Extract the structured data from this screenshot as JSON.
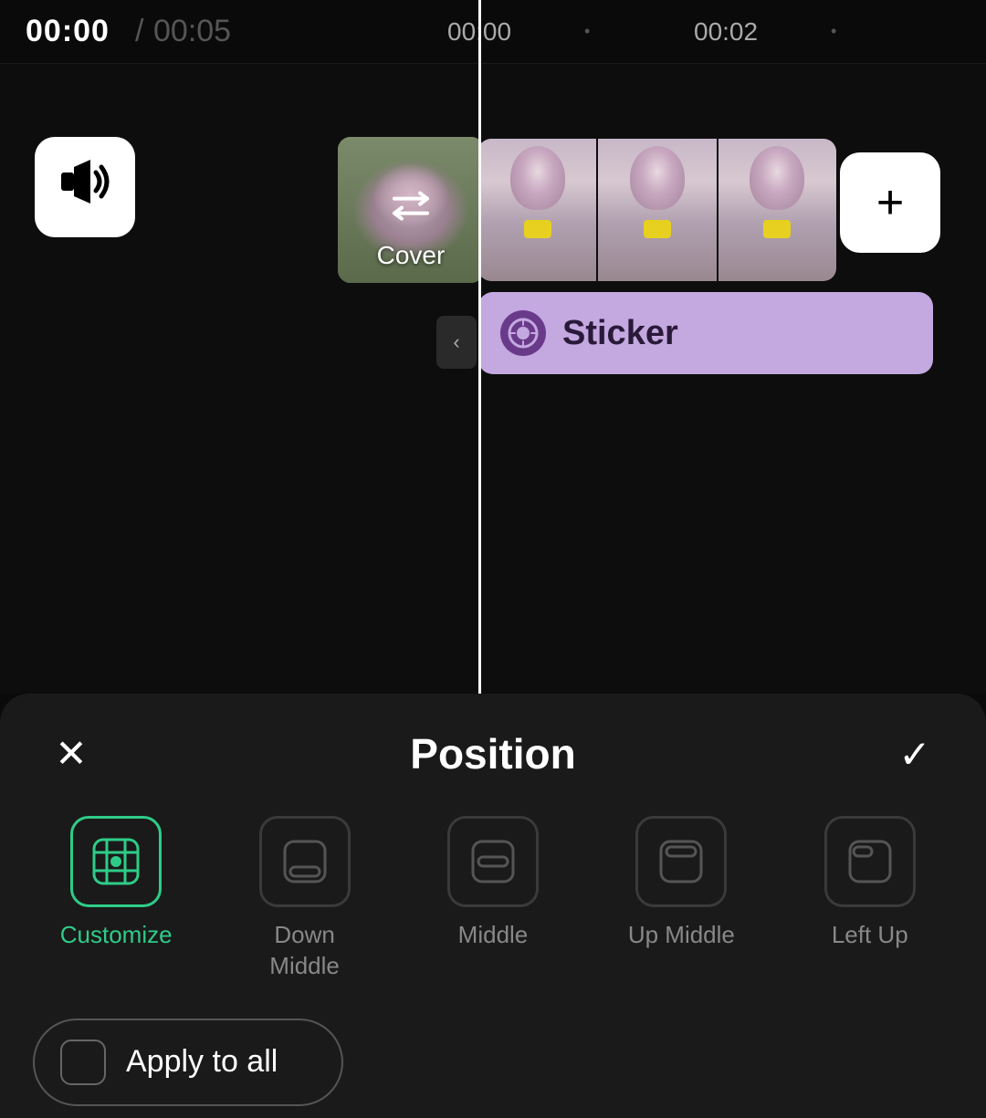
{
  "timeline": {
    "current_time": "00:00",
    "separator": "/",
    "total_time": "00:05",
    "mid_time": "00:00",
    "right_time": "00:02",
    "playhead_color": "#ffffff"
  },
  "cover": {
    "label": "Cover"
  },
  "sticker": {
    "label": "Sticker"
  },
  "position_panel": {
    "title": "Position",
    "close_label": "×",
    "confirm_label": "✓",
    "options": [
      {
        "id": "customize",
        "label": "Customize",
        "active": true
      },
      {
        "id": "down-middle",
        "label": "Down\nMiddle",
        "active": false
      },
      {
        "id": "middle",
        "label": "Middle",
        "active": false
      },
      {
        "id": "up-middle",
        "label": "Up Middle",
        "active": false
      },
      {
        "id": "left-up",
        "label": "Left Up",
        "active": false
      }
    ],
    "apply_all_label": "Apply to all"
  },
  "icons": {
    "audio": "🔊",
    "add": "+",
    "collapse": "‹",
    "swap": "⇄"
  }
}
